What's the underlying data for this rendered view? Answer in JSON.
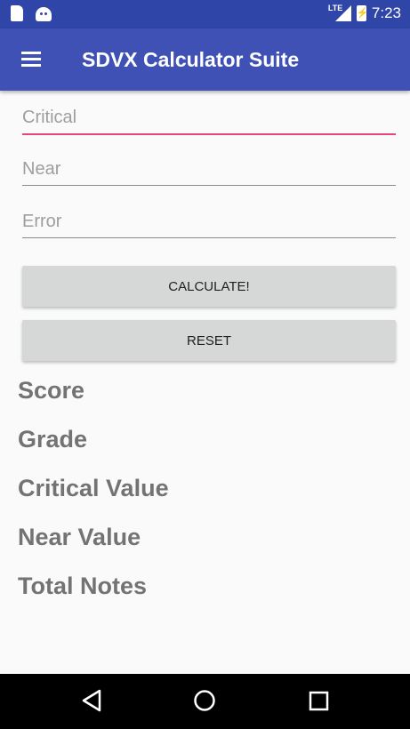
{
  "status_bar": {
    "icons_left": [
      "sd-card-icon",
      "android-icon"
    ],
    "network": "LTE",
    "time": "7:23"
  },
  "app_bar": {
    "menu_icon": "hamburger-menu-icon",
    "title": "SDVX Calculator Suite",
    "color": "#3f51b5"
  },
  "form": {
    "critical": {
      "placeholder": "Critical",
      "value": ""
    },
    "near": {
      "placeholder": "Near",
      "value": ""
    },
    "error": {
      "placeholder": "Error",
      "value": ""
    },
    "calculate_label": "CALCULATE!",
    "reset_label": "RESET",
    "focus_color": "#e8437a"
  },
  "results": {
    "score": "Score",
    "grade": "Grade",
    "critical_value": "Critical Value",
    "near_value": "Near Value",
    "total_notes": "Total Notes"
  },
  "nav_bar": {
    "icons": [
      "back-icon",
      "home-icon",
      "recents-icon"
    ]
  }
}
